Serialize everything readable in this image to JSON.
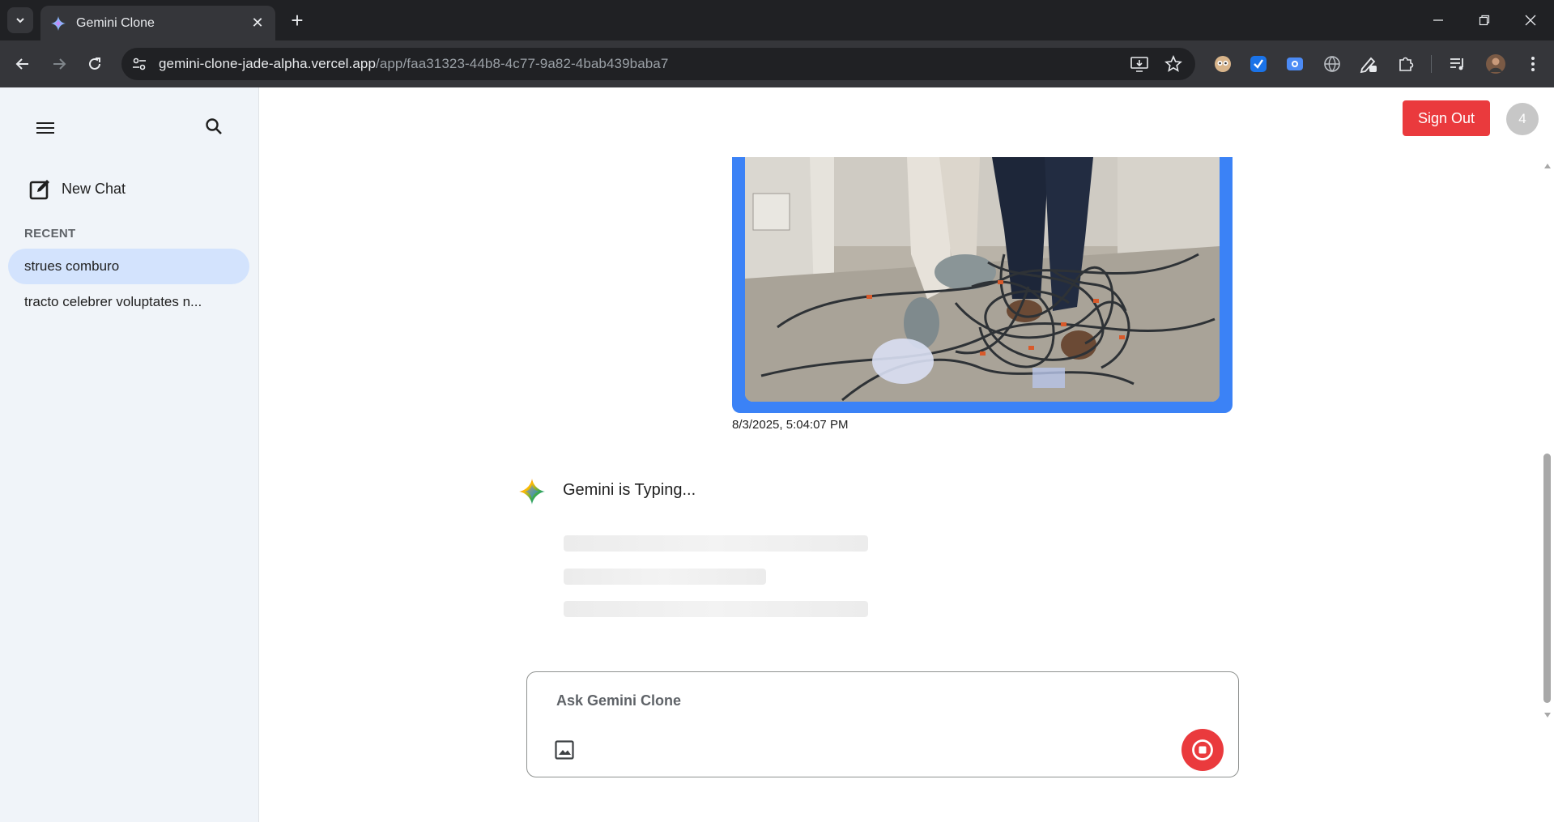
{
  "browser": {
    "tab_title": "Gemini Clone",
    "url_host": "gemini-clone-jade-alpha.vercel.app",
    "url_path": "/app/faa31323-44b8-4c77-9a82-4bab439baba7"
  },
  "sidebar": {
    "new_chat_label": "New Chat",
    "recent_heading": "RECENT",
    "chats": [
      {
        "title": "strues comburo",
        "active": true
      },
      {
        "title": "tracto celebrer voluptates n..."
      }
    ]
  },
  "header": {
    "sign_out_label": "Sign Out",
    "avatar_text": "4"
  },
  "conversation": {
    "message_timestamp": "8/3/2025, 5:04:07 PM",
    "typing_text": "Gemini is Typing..."
  },
  "composer": {
    "placeholder": "Ask Gemini Clone"
  },
  "colors": {
    "accent_red": "#ea3a3d",
    "image_border_blue": "#3b82f6",
    "sidebar_bg": "#f0f4f9",
    "active_chat_bg": "#d3e3fd"
  }
}
